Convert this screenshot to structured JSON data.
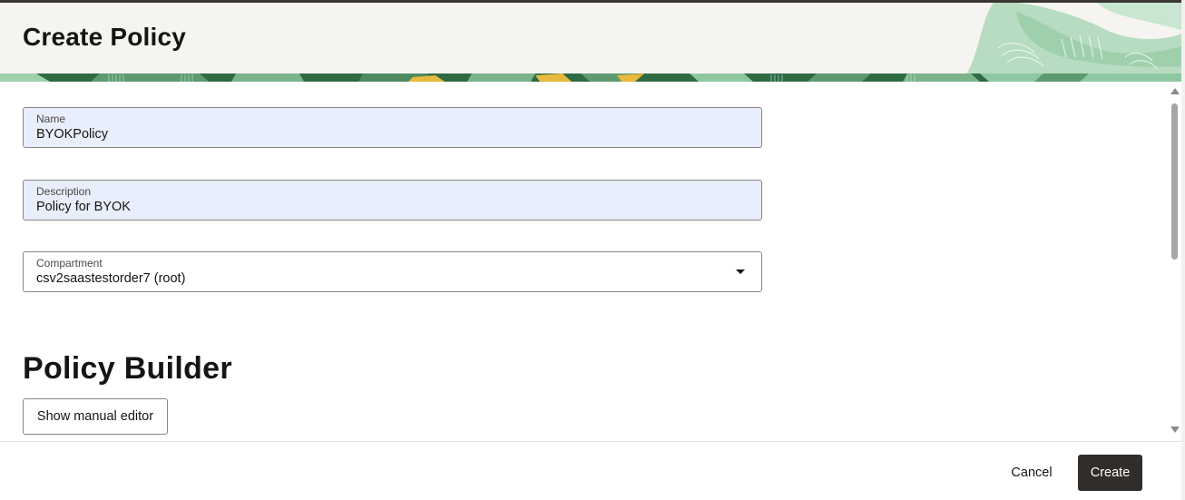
{
  "page": {
    "title": "Create Policy"
  },
  "form": {
    "name": {
      "label": "Name",
      "value": "BYOKPolicy"
    },
    "description": {
      "label": "Description",
      "value": "Policy for BYOK"
    },
    "compartment": {
      "label": "Compartment",
      "value": "csv2saastestorder7 (root)"
    }
  },
  "builder": {
    "title": "Policy Builder",
    "manual_editor_label": "Show manual editor"
  },
  "footer": {
    "cancel_label": "Cancel",
    "create_label": "Create"
  },
  "icons": {
    "dropdown": "chevron-down-icon",
    "scroll_up": "scroll-up-icon",
    "scroll_down": "scroll-down-icon"
  },
  "colors": {
    "header_bg": "#f6f4f1",
    "field_filled_bg": "#e8eefb",
    "primary_button": "#312d2a",
    "banner_green": "#2e6b45",
    "banner_light_green": "#8fc7a2",
    "banner_yellow": "#e8b93c"
  }
}
